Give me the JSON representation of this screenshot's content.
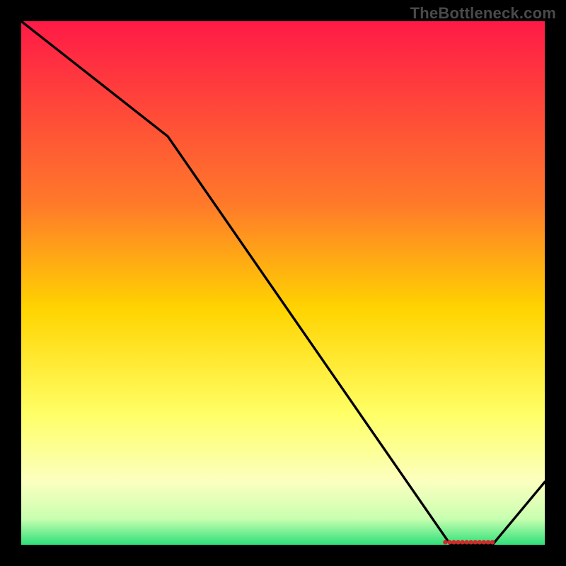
{
  "watermark": "TheBottleneck.com",
  "chart_data": {
    "type": "line",
    "title": "",
    "xlabel": "",
    "ylabel": "",
    "xlim": [
      0,
      100
    ],
    "ylim": [
      0,
      100
    ],
    "x": [
      0,
      28,
      82,
      90,
      100
    ],
    "values": [
      100,
      78,
      0,
      0,
      12
    ],
    "annotation_dots": {
      "y": 0.5,
      "x_start": 81,
      "x_end": 90,
      "count": 12
    },
    "gradient_stops": [
      {
        "offset": 0,
        "color": "#ff1a47"
      },
      {
        "offset": 35,
        "color": "#ff7a2a"
      },
      {
        "offset": 55,
        "color": "#ffd400"
      },
      {
        "offset": 75,
        "color": "#ffff66"
      },
      {
        "offset": 88,
        "color": "#fbffbf"
      },
      {
        "offset": 95,
        "color": "#c9ffb0"
      },
      {
        "offset": 100,
        "color": "#2fe07a"
      }
    ]
  }
}
